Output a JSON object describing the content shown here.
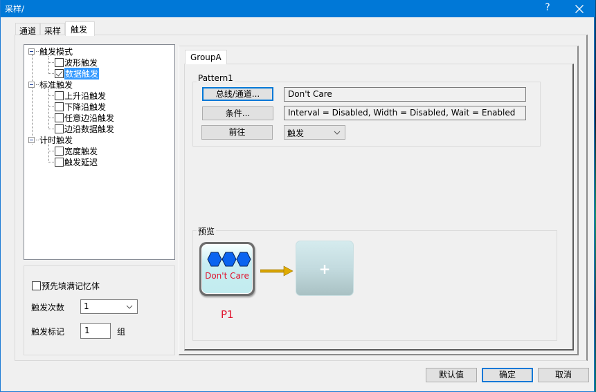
{
  "window": {
    "title": "采样/",
    "help_label": "?",
    "accent_color": "#0078d7"
  },
  "tabs": [
    {
      "label": "通道",
      "active": false
    },
    {
      "label": "采样",
      "active": false
    },
    {
      "label": "触发",
      "active": true
    }
  ],
  "tree": {
    "groups": [
      {
        "label": "触发模式",
        "expanded": true,
        "items": [
          {
            "label": "波形触发",
            "checked": false,
            "selected": false
          },
          {
            "label": "数据触发",
            "checked": true,
            "selected": true
          }
        ]
      },
      {
        "label": "标准触发",
        "expanded": true,
        "items": [
          {
            "label": "上升沿触发",
            "checked": false,
            "selected": false
          },
          {
            "label": "下降沿触发",
            "checked": false,
            "selected": false
          },
          {
            "label": "任意边沿触发",
            "checked": false,
            "selected": false
          },
          {
            "label": "边沿数据触发",
            "checked": false,
            "selected": false
          }
        ]
      },
      {
        "label": "计时触发",
        "expanded": true,
        "items": [
          {
            "label": "宽度触发",
            "checked": false,
            "selected": false
          },
          {
            "label": "触发延迟",
            "checked": false,
            "selected": false
          }
        ]
      }
    ]
  },
  "options": {
    "prefill_label": "预先填满记忆体",
    "prefill_checked": false,
    "trigger_count_label": "触发次数",
    "trigger_count_value": "1",
    "trigger_mark_label": "触发标记",
    "trigger_mark_value": "1",
    "trigger_mark_unit": "组"
  },
  "group": {
    "tab_label": "GroupA",
    "pattern": {
      "legend": "Pattern1",
      "bus_button": "总线/通道...",
      "bus_value": "Don't Care",
      "condition_button": "条件...",
      "condition_value": "Interval = Disabled, Width = Disabled, Wait = Enabled",
      "goto_button": "前往",
      "goto_select": "触发"
    },
    "preview": {
      "legend": "预览",
      "card_text": "Don't Care",
      "card_label": "P1",
      "add_symbol": "+",
      "card_text_color": "#e0102a",
      "hex_color": "#0a64f0",
      "arrow_color": "#d8a400"
    }
  },
  "footer": {
    "default_button": "默认值",
    "ok_button": "确定",
    "cancel_button": "取消"
  }
}
